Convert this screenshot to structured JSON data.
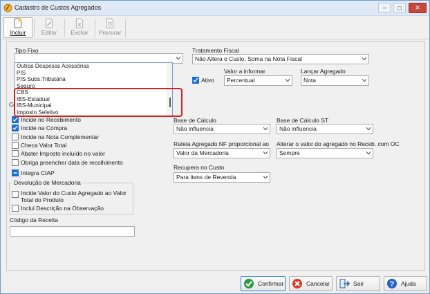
{
  "window": {
    "title": "Cadastro de Custos Agregados",
    "controls": {
      "minimize": "–",
      "maximize": "□",
      "close": "✕"
    }
  },
  "toolbar": {
    "incluir": "Incluir",
    "editar": "Editar",
    "excluir": "Excluir",
    "procurar": "Procurar"
  },
  "tipo_fixo": {
    "label": "Tipo Fixo",
    "value": "",
    "options": [
      "Outras Despesas Acessórias",
      "PIS",
      "PIS Subs.Tributária",
      "Seguro",
      "CBS",
      "IBS-Estadual",
      "IBS-Municipal",
      "Imposto Seletivo"
    ]
  },
  "tratamento_fiscal": {
    "label": "Tratamento Fiscal",
    "value": "Não Altera o Custo, Soma na Nota Fiscal"
  },
  "ativo": {
    "label": "Ativo",
    "checked": true
  },
  "valor_a_informar": {
    "label": "Valor a informar",
    "value": "Percentual"
  },
  "lancar_agregado": {
    "label": "Lançar Agregado",
    "value": "Nota"
  },
  "section_label": "Co",
  "checks": [
    {
      "label": "Incide no Recebimento",
      "checked": true
    },
    {
      "label": "Incide na Compra",
      "checked": true
    },
    {
      "label": "Incide na Nota Complementar",
      "checked": false
    },
    {
      "label": "Checa Valor Total",
      "checked": false
    },
    {
      "label": "Abater Imposto incluído no valor",
      "checked": false
    },
    {
      "label": "Obriga preencher data de recolhimento",
      "checked": false
    },
    {
      "label": "Integra CIAP",
      "checked": true
    }
  ],
  "devolucao": {
    "title": "Devolução de Mercadoria",
    "check1": "Incide Valor do Custo Agregado ao Valor Total do Produto",
    "check1_line1": "Incide Valor do Custo Agregado ao Valor",
    "check1_line2": "Total do Produto",
    "check2": "Inclui Descrição na Observação"
  },
  "codigo_receita": {
    "label": "Código da Receita",
    "value": ""
  },
  "base_calculo": {
    "label": "Base de Cálculo",
    "value": "Não influencia"
  },
  "base_calculo_st": {
    "label": "Base de Cálculo ST",
    "value": "Não influencia"
  },
  "rateia": {
    "label": "Rateia Agregado NF proporcional ao",
    "value": "Valor da Mercadoria"
  },
  "alterar_valor": {
    "label": "Alterar o valor do agregado no Receb. com OC",
    "value": "Sempre"
  },
  "recupera": {
    "label": "Recupera no Custo",
    "value": "Para itens de Revenda"
  },
  "buttons": {
    "confirmar": "Confirmar",
    "cancelar": "Cancelar",
    "sair": "Sair",
    "ajuda": "Ajuda"
  },
  "colors": {
    "accent": "#1b6fd1",
    "highlight": "#d62020",
    "close": "#c9463b"
  }
}
